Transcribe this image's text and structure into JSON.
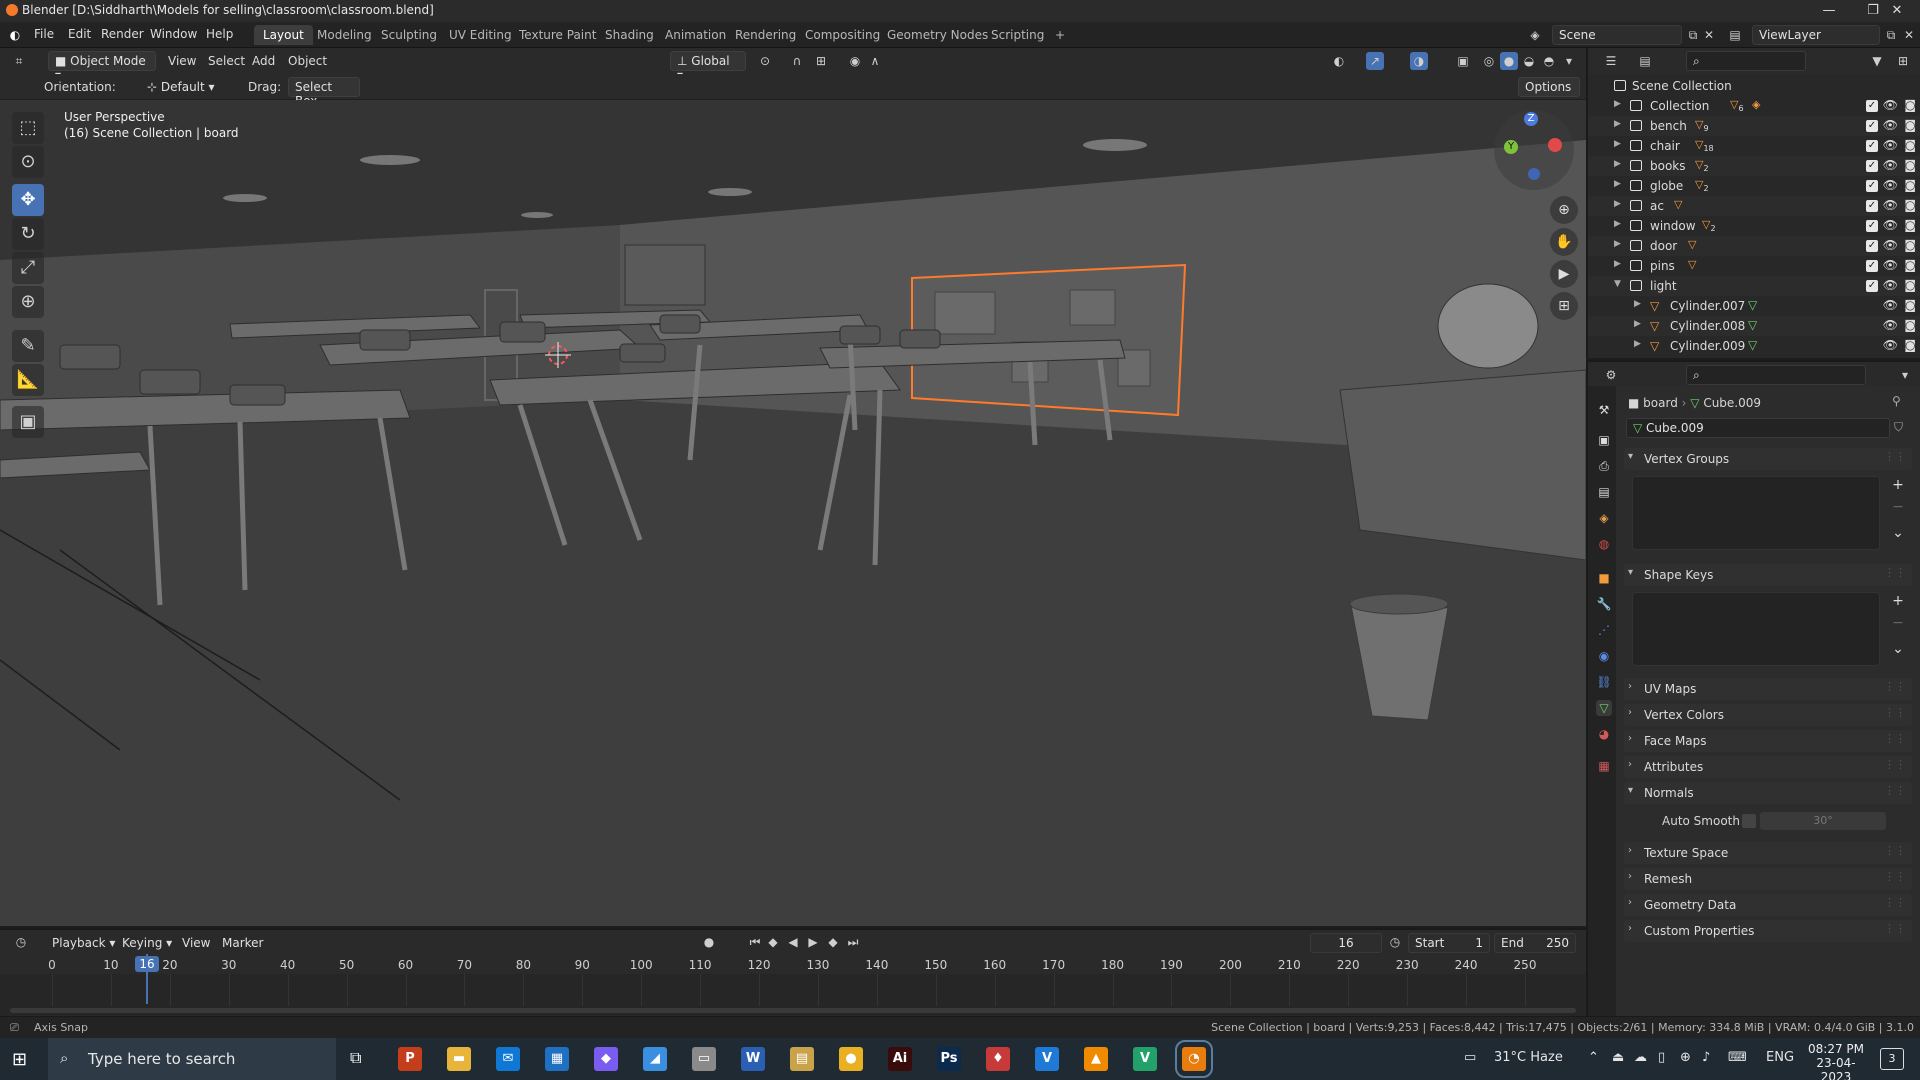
{
  "window": {
    "title": "Blender [D:\\Siddharth\\Models for selling\\classroom\\classroom.blend]",
    "controls": [
      "—",
      "❐",
      "✕"
    ]
  },
  "menu": [
    "File",
    "Edit",
    "Render",
    "Window",
    "Help"
  ],
  "workspaces": [
    "Layout",
    "Modeling",
    "Sculpting",
    "UV Editing",
    "Texture Paint",
    "Shading",
    "Animation",
    "Rendering",
    "Compositing",
    "Geometry Nodes",
    "Scripting"
  ],
  "add_workspace": "+",
  "scene": {
    "label": "Scene",
    "view_layer": "ViewLayer"
  },
  "viewport_header": {
    "mode": "Object Mode",
    "menus": [
      "View",
      "Select",
      "Add",
      "Object"
    ],
    "transform": "Global",
    "options": "Options"
  },
  "tool_settings": {
    "orientation_label": "Orientation:",
    "orientation_value": "Default",
    "drag_label": "Drag:",
    "drag_value": "Select Box"
  },
  "viewport": {
    "perspective": "User Perspective",
    "context": "(16) Scene Collection | board",
    "gizmo": {
      "z": "Z",
      "y": "Y"
    }
  },
  "outliner": {
    "root": "Scene Collection",
    "items": [
      {
        "label": "Collection",
        "badge": "6",
        "level": 0,
        "expanded": false
      },
      {
        "label": "bench",
        "badge": "9",
        "level": 0,
        "expanded": false
      },
      {
        "label": "chair",
        "badge": "18",
        "level": 0,
        "expanded": false
      },
      {
        "label": "books",
        "badge": "2",
        "level": 0,
        "expanded": false
      },
      {
        "label": "globe",
        "badge": "2",
        "level": 0,
        "expanded": false
      },
      {
        "label": "ac",
        "badge": "",
        "level": 0,
        "expanded": false
      },
      {
        "label": "window",
        "badge": "2",
        "level": 0,
        "expanded": false
      },
      {
        "label": "door",
        "badge": "",
        "level": 0,
        "expanded": false
      },
      {
        "label": "pins",
        "badge": "",
        "level": 0,
        "expanded": false
      },
      {
        "label": "light",
        "badge": "",
        "level": 0,
        "expanded": true
      },
      {
        "label": "Cylinder.007",
        "badge": "",
        "level": 1,
        "expanded": false
      },
      {
        "label": "Cylinder.008",
        "badge": "",
        "level": 1,
        "expanded": false
      },
      {
        "label": "Cylinder.009",
        "badge": "",
        "level": 1,
        "expanded": false
      }
    ]
  },
  "properties": {
    "breadcrumb_object": "board",
    "breadcrumb_data": "Cube.009",
    "data_name": "Cube.009",
    "panels": [
      {
        "label": "Vertex Groups",
        "open": true
      },
      {
        "label": "Shape Keys",
        "open": true
      },
      {
        "label": "UV Maps",
        "open": false
      },
      {
        "label": "Vertex Colors",
        "open": false
      },
      {
        "label": "Face Maps",
        "open": false
      },
      {
        "label": "Attributes",
        "open": false
      },
      {
        "label": "Normals",
        "open": true
      },
      {
        "label": "Texture Space",
        "open": false
      },
      {
        "label": "Remesh",
        "open": false
      },
      {
        "label": "Geometry Data",
        "open": false
      },
      {
        "label": "Custom Properties",
        "open": false
      }
    ],
    "auto_smooth_label": "Auto Smooth",
    "auto_smooth_angle": "30°"
  },
  "timeline": {
    "menus": [
      "Playback",
      "Keying",
      "View",
      "Marker"
    ],
    "current_frame": "16",
    "start_label": "Start",
    "start": "1",
    "end_label": "End",
    "end": "250",
    "ticks": [
      "0",
      "10",
      "20",
      "30",
      "40",
      "50",
      "60",
      "70",
      "80",
      "90",
      "100",
      "110",
      "120",
      "130",
      "140",
      "150",
      "160",
      "170",
      "180",
      "190",
      "200",
      "210",
      "220",
      "230",
      "240",
      "250"
    ]
  },
  "statusbar": {
    "left": "Axis Snap",
    "right": "Scene Collection | board | Verts:9,253 | Faces:8,442 | Tris:17,475 | Objects:2/61 | Memory: 334.8 MiB | VRAM: 0.4/4.0 GiB | 3.1.0"
  },
  "taskbar": {
    "search_placeholder": "Type here to search",
    "weather": "31°C Haze",
    "lang": "ENG",
    "time": "08:27 PM",
    "date": "23-04-2023",
    "notifications": "3",
    "apps": [
      {
        "name": "PowerPoint",
        "glyph": "P",
        "color": "#c43e1c"
      },
      {
        "name": "File Explorer",
        "glyph": "▬",
        "color": "#e8b43a"
      },
      {
        "name": "Mail",
        "glyph": "✉",
        "color": "#0f78d4"
      },
      {
        "name": "Store",
        "glyph": "▦",
        "color": "#1f6fc2"
      },
      {
        "name": "Copilot",
        "glyph": "◆",
        "color": "#7a5cf0"
      },
      {
        "name": "Shortcut",
        "glyph": "◢",
        "color": "#3b8fe0"
      },
      {
        "name": "Vmware",
        "glyph": "▭",
        "color": "#8a8a8a"
      },
      {
        "name": "Word",
        "glyph": "W",
        "color": "#2b5fb4"
      },
      {
        "name": "Archive",
        "glyph": "▤",
        "color": "#c9a24a"
      },
      {
        "name": "Chrome",
        "glyph": "●",
        "color": "#e9b021"
      },
      {
        "name": "Illustrator",
        "glyph": "Ai",
        "color": "#3a0b0b"
      },
      {
        "name": "Photoshop",
        "glyph": "Ps",
        "color": "#0c2a4c"
      },
      {
        "name": "Substance",
        "glyph": "♦",
        "color": "#c63a3a"
      },
      {
        "name": "Vectary",
        "glyph": "V",
        "color": "#1e7ad6"
      },
      {
        "name": "VLC",
        "glyph": "▲",
        "color": "#f08a00"
      },
      {
        "name": "Vegas",
        "glyph": "V",
        "color": "#22a26a"
      },
      {
        "name": "Blender",
        "glyph": "◔",
        "color": "#e87d0d"
      }
    ]
  }
}
